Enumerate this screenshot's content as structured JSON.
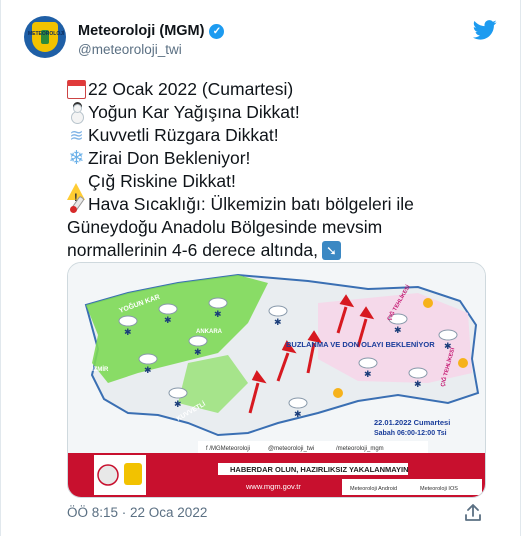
{
  "account": {
    "display_name": "Meteoroloji (MGM)",
    "handle": "@meteoroloji_twi",
    "avatar_text": "METEOROLOJİ",
    "verified_icon": "verified-badge-icon",
    "brand_icon": "twitter-bird-icon"
  },
  "tweet": {
    "lines": [
      {
        "icon": "calendar-icon",
        "text": "22 Ocak 2022 (Cumartesi)"
      },
      {
        "icon": "snowman-icon",
        "text": "Yoğun Kar Yağışına Dikkat!"
      },
      {
        "icon": "wind-icon",
        "text": "Kuvvetli Rüzgara Dikkat!"
      },
      {
        "icon": "snowflake-icon",
        "text": "Zirai Don Bekleniyor!"
      },
      {
        "icon": "warning-icon",
        "text": "Çığ Riskine Dikkat!"
      },
      {
        "icon": "thermometer-icon",
        "text": "Hava Sıcaklığı:  Ülkemizin batı bölgeleri ile"
      },
      {
        "icon": "",
        "text": "Güneydoğu Anadolu Bölgesinde mevsim"
      },
      {
        "icon": "",
        "text": "normallerinin 4-6 derece altında,"
      }
    ],
    "trailing_icon": "arrow-down-right-icon"
  },
  "media": {
    "map_labels": {
      "yogun_kar": "YOĞUN KAR",
      "ankara": "ANKARA",
      "izmir": "İZMİR",
      "buzlanma": "BUZLANMA VE DON OLAYI BEKLENİYOR",
      "kuvvetli": "KUVVETLİ",
      "cig": "ÇIĞ TEHLİKESİ",
      "cig2": "ÇIĞ TEHLİKESİ"
    },
    "date_line": "22.01.2022 Cumartesi",
    "time_line": "Sabah 06:00-12:00 Tsi",
    "socials": [
      "f  /MGMeteoroloji",
      "@meteoroloji_twi",
      "/meteoroloji_mgm"
    ],
    "banner_text": "HABERDAR OLUN, HAZIRLIKSIZ YAKALANMAYIN",
    "website": "www.mgm.gov.tr",
    "app_links": [
      "Meteoroloji Android",
      "Meteoroloji IOS"
    ],
    "colors": {
      "snow_green": "#7ed957",
      "banner_red": "#c8102e",
      "sea": "#ffffff"
    }
  },
  "meta": {
    "time": "ÖÖ 8:15 · 22 Oca 2022"
  }
}
